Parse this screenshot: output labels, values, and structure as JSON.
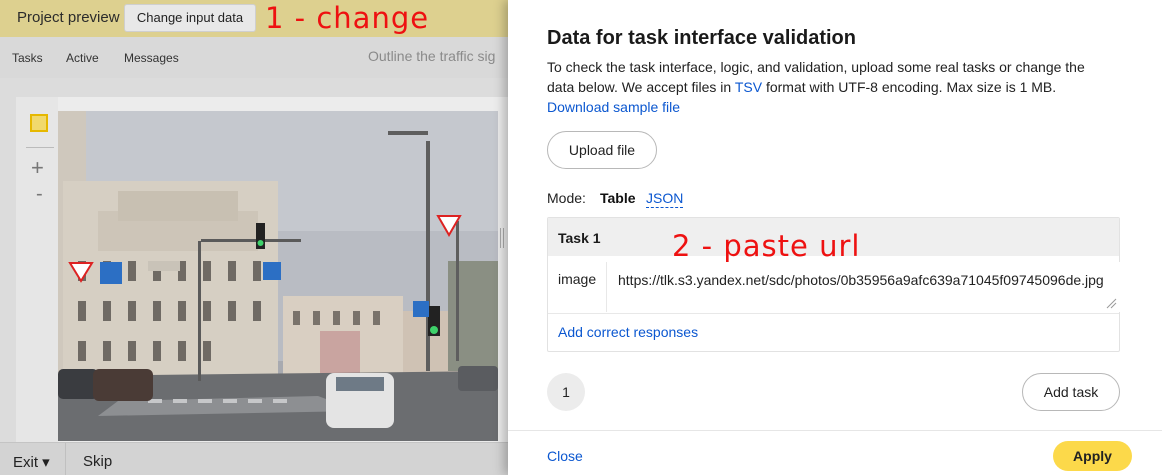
{
  "header": {
    "title": "Project preview",
    "change_button": "Change input data",
    "annotation_1": "1 - change"
  },
  "nav": {
    "items": [
      "Tasks",
      "Active",
      "Messages"
    ],
    "instruction": "Outline the traffic sig"
  },
  "toolbar": {
    "zoom_in": "+",
    "zoom_out": "-"
  },
  "bottom": {
    "exit": "Exit ▾",
    "skip": "Skip"
  },
  "drawer": {
    "title": "Data for task interface validation",
    "description_text": "To check the task interface, logic, and validation, upload some real tasks or change the data below. We accept files in ",
    "tsv_link": "TSV",
    "description_mid": " format with UTF-8 encoding. Max size is 1 MB. ",
    "download_link": "Download sample file",
    "upload_button": "Upload file",
    "mode_label": "Mode:",
    "mode_table": "Table",
    "mode_json": "JSON",
    "task": {
      "header": "Task 1",
      "field_name": "image",
      "field_value": "https://tlk.s3.yandex.net/sdc/photos/0b35956a9afc639a71045f09745096de.jpg",
      "add_responses": "Add correct responses"
    },
    "annotation_2": "2 - paste url",
    "page_number": "1",
    "add_task_button": "Add task",
    "close_link": "Close",
    "apply_button": "Apply"
  },
  "colors": {
    "header_bg": "#ddd08f",
    "link": "#0b57d0",
    "apply": "#fcd94a",
    "annotation": "#ee1111"
  }
}
